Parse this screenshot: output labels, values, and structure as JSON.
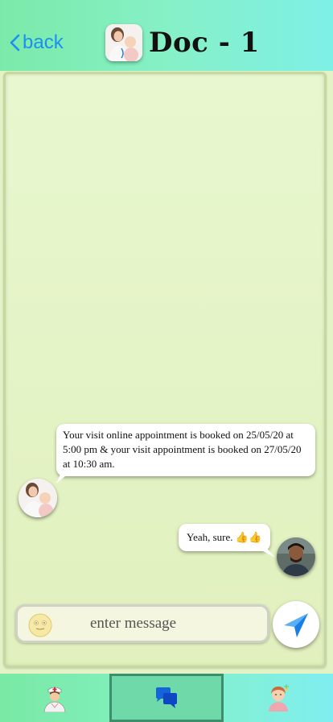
{
  "header": {
    "back_label": "back",
    "title": "Doc - 1"
  },
  "messages": [
    {
      "sender": "doctor",
      "text": "Your visit online appointment is booked on 25/05/20 at 5:00 pm & your visit appointment is booked on 27/05/20 at 10:30 am."
    },
    {
      "sender": "user",
      "text": "Yeah, sure. 👍👍"
    }
  ],
  "composer": {
    "placeholder": "enter message"
  },
  "tabs": [
    {
      "name": "doctor",
      "icon": "nurse-icon",
      "active": false
    },
    {
      "name": "chat",
      "icon": "chat-icon",
      "active": true
    },
    {
      "name": "profile",
      "icon": "patient-icon",
      "active": false
    }
  ],
  "colors": {
    "header_gradient_start": "#7beaa9",
    "header_gradient_end": "#7ef0e6",
    "accent_blue": "#1d8ff0",
    "chat_background": "#e4f3c6"
  }
}
